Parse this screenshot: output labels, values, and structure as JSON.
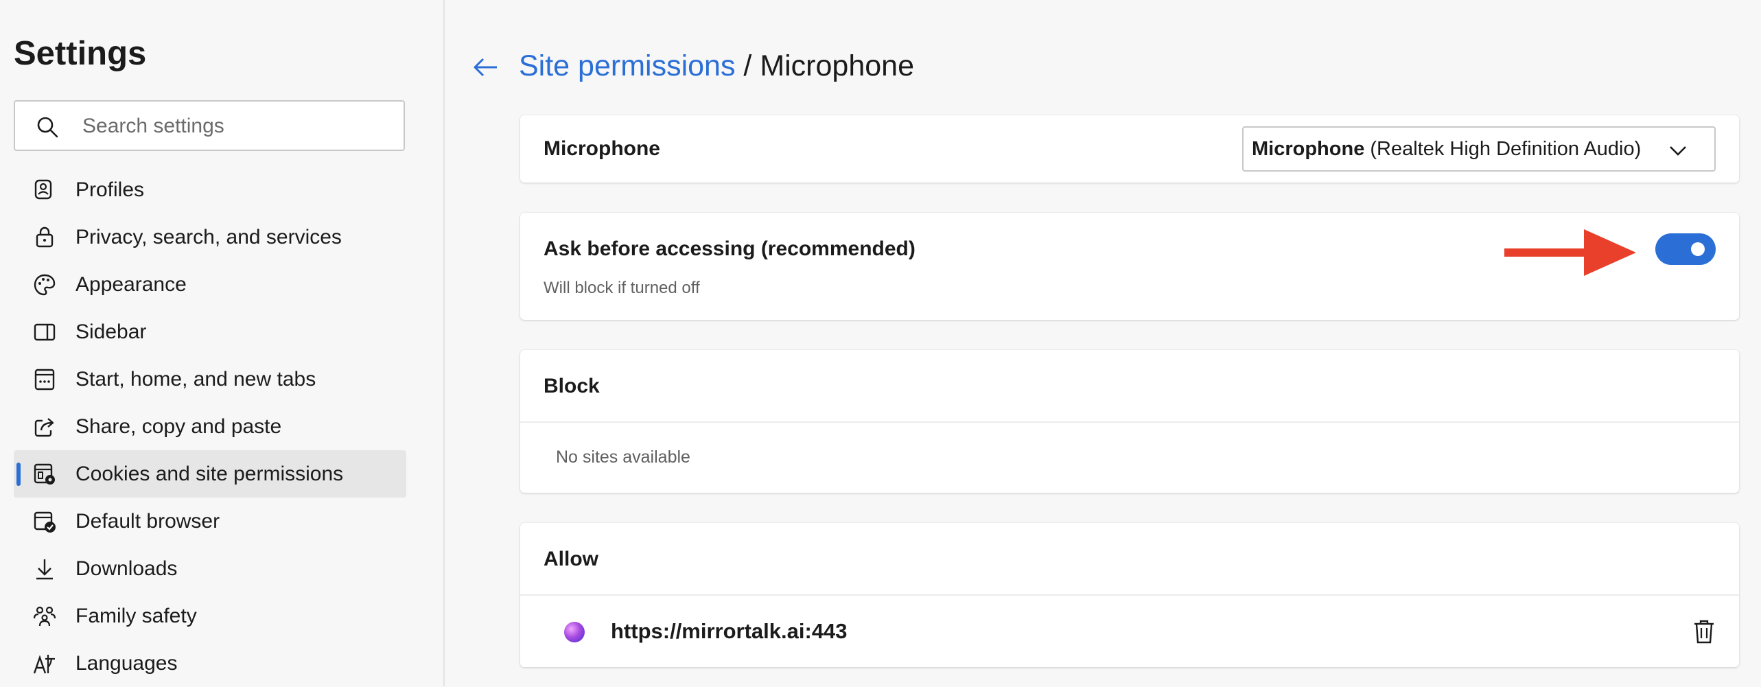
{
  "sidebar": {
    "title": "Settings",
    "search_placeholder": "Search settings",
    "items": [
      {
        "label": "Profiles",
        "icon": "profile-icon"
      },
      {
        "label": "Privacy, search, and services",
        "icon": "lock-icon"
      },
      {
        "label": "Appearance",
        "icon": "palette-icon"
      },
      {
        "label": "Sidebar",
        "icon": "sidebar-icon"
      },
      {
        "label": "Start, home, and new tabs",
        "icon": "home-tabs-icon"
      },
      {
        "label": "Share, copy and paste",
        "icon": "share-icon"
      },
      {
        "label": "Cookies and site permissions",
        "icon": "cookies-icon",
        "active": true
      },
      {
        "label": "Default browser",
        "icon": "default-browser-icon"
      },
      {
        "label": "Downloads",
        "icon": "download-icon"
      },
      {
        "label": "Family safety",
        "icon": "family-icon"
      },
      {
        "label": "Languages",
        "icon": "languages-icon"
      }
    ]
  },
  "header": {
    "breadcrumb_link": "Site permissions",
    "separator": "/",
    "current": "Microphone"
  },
  "microphone_card": {
    "label": "Microphone",
    "select_strong": "Microphone",
    "select_rest": "(Realtek High Definition Audio)"
  },
  "ask_card": {
    "label": "Ask before accessing (recommended)",
    "sublabel": "Will block if turned off",
    "toggle_on": true
  },
  "block_card": {
    "label": "Block",
    "empty_text": "No sites available"
  },
  "allow_card": {
    "label": "Allow",
    "sites": [
      {
        "url": "https://mirrortalk.ai:443"
      }
    ]
  },
  "colors": {
    "accent": "#2b6fd6",
    "annotation_arrow": "#e8402b"
  }
}
